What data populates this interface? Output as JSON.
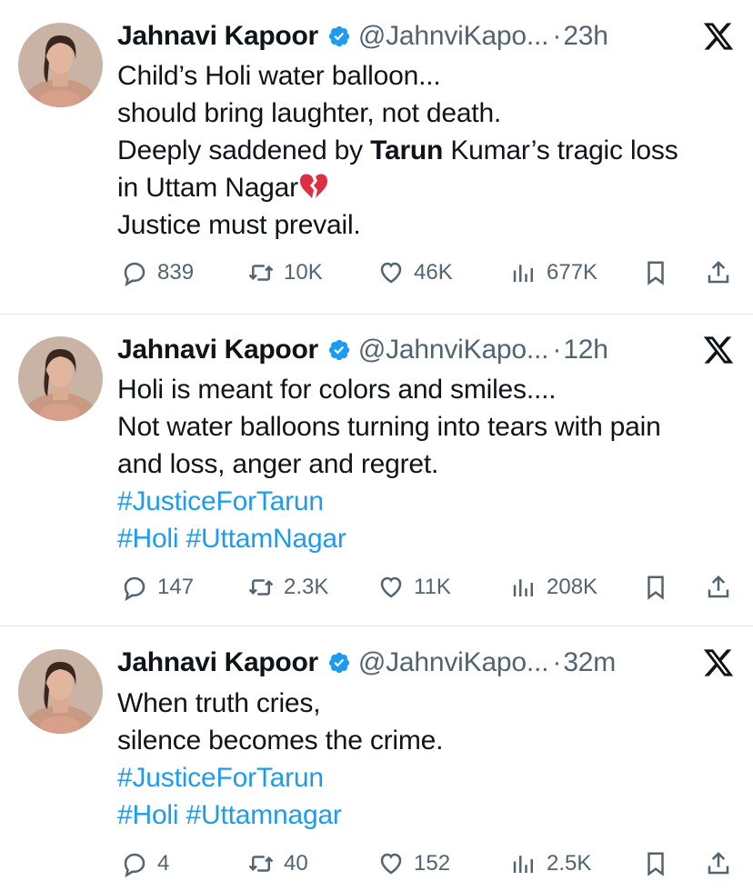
{
  "colors": {
    "link": "#1d9bf0",
    "secondary": "#536471",
    "verified": "#1d9bf0"
  },
  "tweets": [
    {
      "name": "Jahnavi Kapoor",
      "handle": "@JahnviKapo...",
      "separator": "·",
      "time": "23h",
      "lines": [
        {
          "text": "Child’s Holi water balloon..."
        },
        {
          "text": "should bring laughter, not death."
        },
        {
          "pre": "Deeply saddened by ",
          "bold": "Tarun",
          "post": " Kumar’s tragic loss"
        },
        {
          "text": "in Uttam Nagar",
          "emoji": "broken-heart-icon"
        },
        {
          "text": "Justice must prevail."
        }
      ],
      "replies": "839",
      "reposts": "10K",
      "likes": "46K",
      "views": "677K"
    },
    {
      "name": "Jahnavi Kapoor",
      "handle": "@JahnviKapo...",
      "separator": "·",
      "time": "12h",
      "lines": [
        {
          "text": "Holi is meant for colors and smiles...."
        },
        {
          "text": "Not water balloons turning into tears with pain"
        },
        {
          "text": "and loss, anger and regret."
        },
        {
          "hashtags": "#JusticeForTarun"
        },
        {
          "hashtags": "#Holi #UttamNagar"
        }
      ],
      "replies": "147",
      "reposts": "2.3K",
      "likes": "11K",
      "views": "208K"
    },
    {
      "name": "Jahnavi Kapoor",
      "handle": "@JahnviKapo...",
      "separator": "·",
      "time": "32m",
      "lines": [
        {
          "text": "When truth cries,"
        },
        {
          "text": "silence becomes the crime."
        },
        {
          "hashtags": "#JusticeForTarun"
        },
        {
          "hashtags": "#Holi #Uttamnagar"
        }
      ],
      "replies": "4",
      "reposts": "40",
      "likes": "152",
      "views": "2.5K"
    }
  ]
}
